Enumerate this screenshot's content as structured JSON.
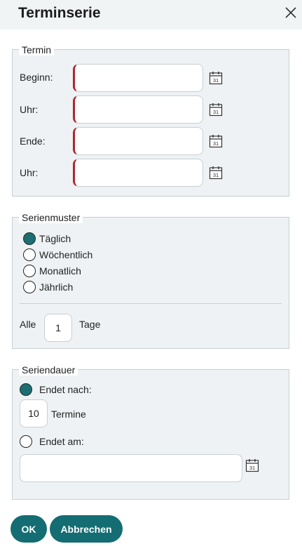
{
  "dialog": {
    "title": "Terminserie"
  },
  "termin": {
    "legend": "Termin",
    "rows": [
      {
        "label": "Beginn:",
        "value": "",
        "calendar_day": "31"
      },
      {
        "label": "Uhr:",
        "value": "",
        "calendar_day": "31"
      },
      {
        "label": "Ende:",
        "value": "",
        "calendar_day": "31"
      },
      {
        "label": "Uhr:",
        "value": "",
        "calendar_day": "31"
      }
    ]
  },
  "serienmuster": {
    "legend": "Serienmuster",
    "options": [
      {
        "label": "Täglich",
        "selected": true
      },
      {
        "label": "Wöchentlich",
        "selected": false
      },
      {
        "label": "Monatlich",
        "selected": false
      },
      {
        "label": "Jährlich",
        "selected": false
      }
    ],
    "interval": {
      "prefix": "Alle",
      "value": "1",
      "suffix": "Tage"
    }
  },
  "seriendauer": {
    "legend": "Seriendauer",
    "ends_after": {
      "label": "Endet nach:",
      "selected": true,
      "count": "10",
      "unit": "Termine"
    },
    "ends_on": {
      "label": "Endet am:",
      "selected": false,
      "value": "",
      "calendar_day": "31"
    }
  },
  "buttons": {
    "ok": "OK",
    "cancel": "Abbrechen"
  },
  "colors": {
    "accent": "#146d72",
    "required": "#b5262c",
    "panel": "#eef2f4"
  }
}
